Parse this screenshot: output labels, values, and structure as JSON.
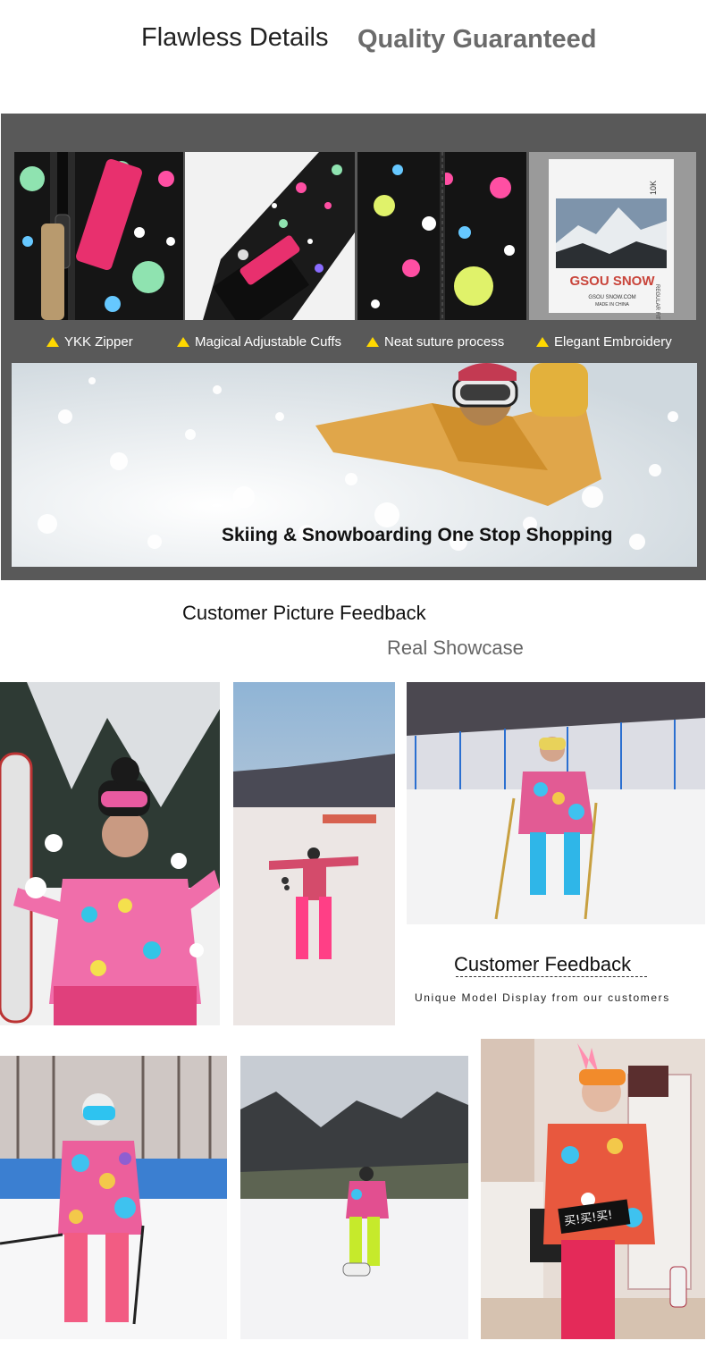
{
  "header": {
    "title": "Flawless Details",
    "subtitle": "Quality Guaranteed"
  },
  "details": {
    "captions": [
      "YKK Zipper",
      "Magical Adjustable Cuffs",
      "Neat suture process",
      "Elegant Embroidery"
    ],
    "label_brand": "GSOU SNOW",
    "label_size": "10K",
    "label_fit": "REGULAR FIT",
    "label_site": "GSOU SNOW.COM",
    "label_origin": "MADE IN CHINA"
  },
  "banner": {
    "caption": "Skiing & Snowboarding One Stop Shopping"
  },
  "feedback": {
    "heading": "Customer Picture Feedback",
    "subheading": "Real Showcase",
    "title": "Customer Feedback",
    "subtitle": "Unique Model Display from our customers",
    "sign_text": "买!买!买!"
  },
  "colors": {
    "accent_triangle": "#ffd800",
    "panel_bg": "#595959",
    "pink": "#ff3f86",
    "jacket_base": "#1b1b1b"
  }
}
